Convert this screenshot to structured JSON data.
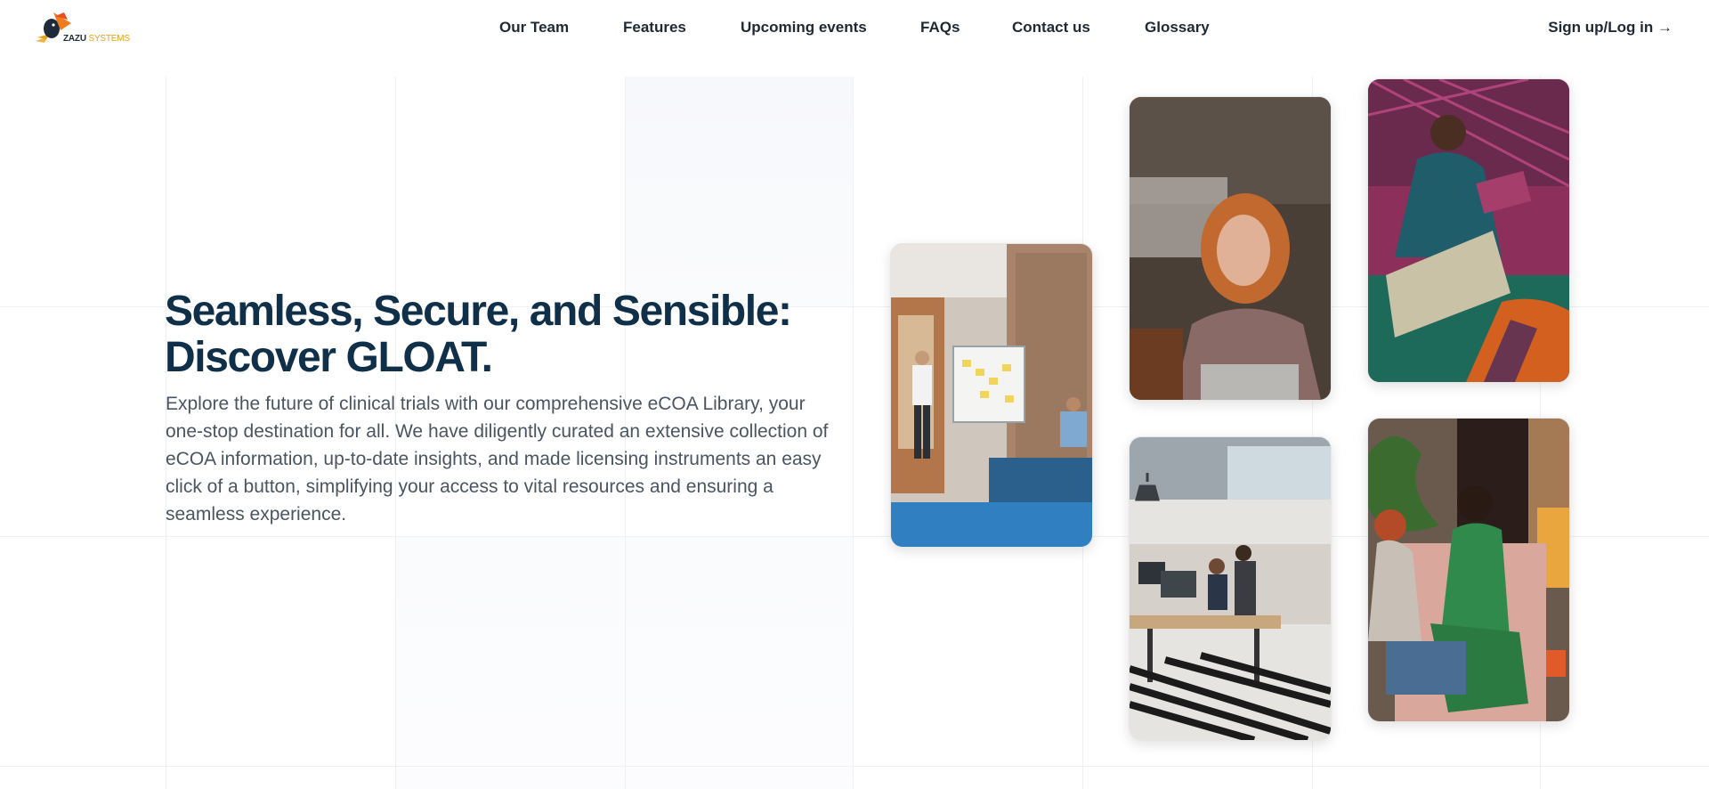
{
  "brand": {
    "name_bold": "ZAZU",
    "name_light": "SYSTEMS",
    "colors": {
      "navy": "#10304a",
      "gold": "#e3a21a",
      "orange": "#f07c1e"
    }
  },
  "nav": {
    "items": [
      {
        "label": "Our Team"
      },
      {
        "label": "Features"
      },
      {
        "label": "Upcoming events"
      },
      {
        "label": "FAQs"
      },
      {
        "label": "Contact us"
      },
      {
        "label": "Glossary"
      }
    ],
    "signup_label": "Sign up/Log in →"
  },
  "hero": {
    "title": "Seamless, Secure, and Sensible: Discover GLOAT.",
    "description": "Explore the future of clinical trials with our comprehensive eCOA Library, your one-stop destination for all. We have diligently curated an extensive collection of eCOA information, up-to-date insights, and made licensing instruments an easy click of a button, simplifying your access to vital resources and ensuring a seamless experience."
  },
  "photos": [
    {
      "subject": "man presenting at whiteboard with sticky notes"
    },
    {
      "subject": "woman with red hair smiling at laptop"
    },
    {
      "subject": "man laughing holding tablet"
    },
    {
      "subject": "open-plan office with desks and people"
    },
    {
      "subject": "two women laughing on sofa with laptop"
    }
  ]
}
